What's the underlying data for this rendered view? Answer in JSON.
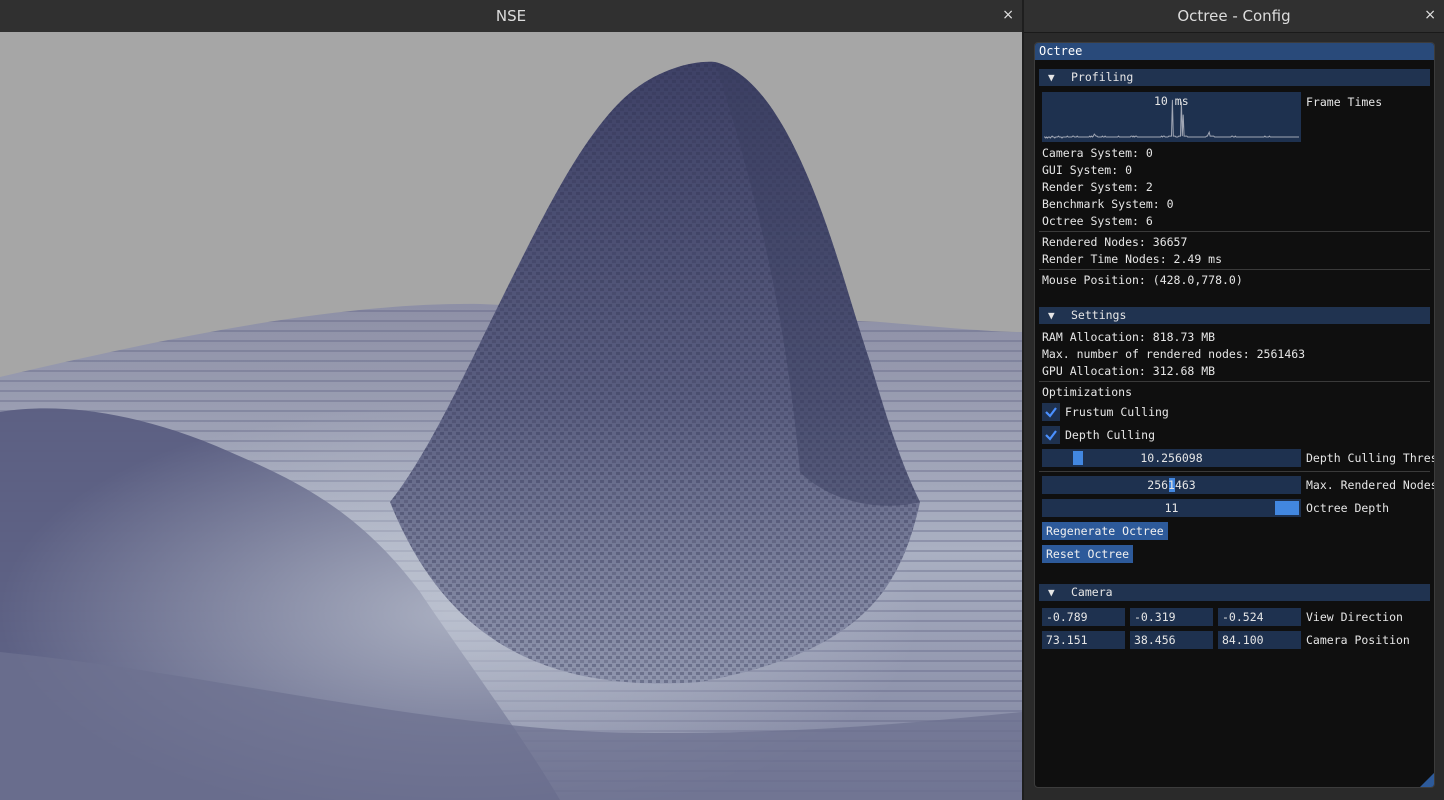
{
  "nse_window": {
    "title": "NSE",
    "close": "×"
  },
  "config_window": {
    "title": "Octree - Config",
    "close": "×"
  },
  "panel": {
    "title": "Octree"
  },
  "profiling": {
    "header": "Profiling",
    "arrow": "▼",
    "plot_overlay": "10 ms",
    "plot_label": "Frame Times",
    "frame_times": [
      2,
      2,
      1,
      2,
      1,
      2,
      2,
      1,
      2,
      3,
      2,
      2,
      1,
      2,
      2,
      2,
      3,
      2,
      2,
      2,
      1,
      2,
      2,
      2,
      2,
      2,
      3,
      2,
      2,
      2,
      2,
      2,
      3,
      3,
      2,
      2,
      2,
      3,
      2,
      2,
      2,
      2,
      2,
      2,
      2,
      2,
      2,
      2,
      2,
      2,
      2,
      3,
      2,
      3,
      2,
      3,
      5,
      4,
      3,
      3,
      2,
      2,
      2,
      2,
      2,
      3,
      2,
      2,
      3,
      2,
      2,
      2,
      2,
      2,
      2,
      2,
      2,
      2,
      2,
      2,
      2,
      2,
      2,
      3,
      2,
      2,
      2,
      2,
      2,
      2,
      2,
      2,
      2,
      2,
      2,
      2,
      2,
      3,
      3,
      2,
      3,
      2,
      3,
      3,
      2,
      2,
      2,
      2,
      2,
      2,
      2,
      2,
      2,
      2,
      2,
      2,
      2,
      2,
      2,
      2,
      2,
      2,
      2,
      2,
      2,
      2,
      2,
      2,
      2,
      2,
      2,
      3,
      2,
      3,
      3,
      2,
      2,
      2,
      2,
      3,
      3,
      3,
      3,
      40,
      3,
      3,
      3,
      2,
      2,
      2,
      3,
      3,
      3,
      38,
      3,
      25,
      3,
      3,
      3,
      3,
      2,
      2,
      2,
      2,
      2,
      2,
      2,
      2,
      2,
      2,
      2,
      2,
      2,
      2,
      2,
      2,
      2,
      2,
      2,
      2,
      2,
      3,
      3,
      5,
      7,
      3,
      3,
      3,
      3,
      3,
      2,
      2,
      2,
      2,
      2,
      2,
      2,
      2,
      2,
      2,
      2,
      2,
      2,
      2,
      2,
      2,
      2,
      2,
      2,
      3,
      3,
      2,
      2,
      3,
      2,
      2,
      2,
      2,
      2,
      2,
      2,
      2,
      2,
      2,
      2,
      2,
      2,
      2,
      2,
      2,
      2,
      2,
      2,
      2,
      2,
      2,
      2,
      2,
      2,
      2,
      2,
      2,
      2,
      2,
      2,
      2,
      3,
      2,
      2,
      2,
      2,
      3,
      2,
      2,
      2,
      2,
      2,
      2,
      2,
      2,
      2,
      2,
      2,
      2,
      2,
      2,
      2,
      2,
      2,
      2,
      2,
      2,
      2,
      2,
      2,
      2,
      2,
      2,
      2,
      2,
      2,
      2,
      2,
      2,
      2
    ],
    "systems": [
      "Camera System: 0",
      "GUI System: 0",
      "Render System: 2",
      "Benchmark System: 0",
      "Octree System: 6"
    ],
    "rendered_nodes": "Rendered Nodes: 36657",
    "render_time": "Render Time Nodes: 2.49 ms",
    "mouse_position": "Mouse Position: (428.0,778.0)"
  },
  "settings": {
    "header": "Settings",
    "arrow": "▼",
    "ram": "RAM Allocation: 818.73 MB",
    "max_nodes": "Max. number of rendered nodes: 2561463",
    "gpu": "GPU Allocation: 312.68 MB",
    "optimizations_label": "Optimizations",
    "frustum_culling": {
      "label": "Frustum Culling",
      "checked": true
    },
    "depth_culling": {
      "label": "Depth Culling",
      "checked": true
    },
    "depth_threshold": {
      "value": "10.256098",
      "label": "Depth Culling Threshold",
      "fraction": 0.12
    },
    "max_rendered": {
      "value": "2561463",
      "label": "Max. Rendered Nodes",
      "fraction": 0.5
    },
    "octree_depth": {
      "value": "11",
      "label": "Octree Depth",
      "fraction": 1.0
    },
    "regenerate_button": "Regenerate Octree",
    "reset_button": "Reset Octree"
  },
  "camera": {
    "header": "Camera",
    "arrow": "▼",
    "view_direction": {
      "values": [
        "-0.789",
        "-0.319",
        "-0.524"
      ],
      "label": "View Direction"
    },
    "camera_position": {
      "values": [
        "73.151",
        "38.456",
        "84.100"
      ],
      "label": "Camera Position"
    }
  },
  "colors": {
    "accent": "#4287e0",
    "frame_bg": "#1e314f",
    "header_bg": "#203350",
    "title_active": "#294a7a",
    "button": "#2d5a9a",
    "sky": "#a6a6a6",
    "terrain": "#4e5276"
  }
}
